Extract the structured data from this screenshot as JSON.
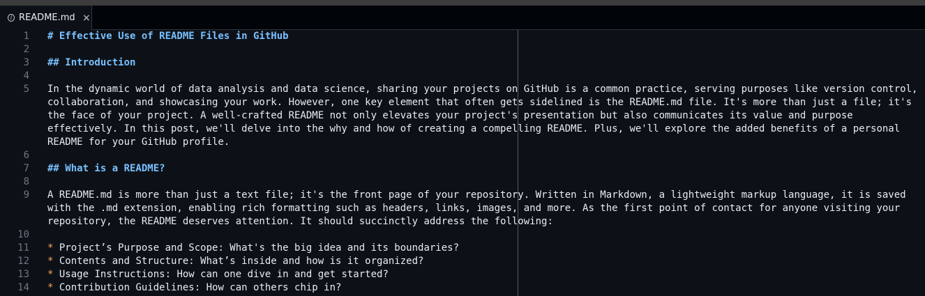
{
  "tab": {
    "filename": "README.md",
    "info_glyph": "i",
    "close_glyph": "×"
  },
  "editor": {
    "lines": [
      {
        "num": "1",
        "text": "# Effective Use of README Files in GitHub"
      },
      {
        "num": "2",
        "text": ""
      },
      {
        "num": "3",
        "text": "## Introduction"
      },
      {
        "num": "4",
        "text": ""
      },
      {
        "num": "5",
        "text": "In the dynamic world of data analysis and data science, sharing your projects on GitHub is a common practice, serving purposes like version control,"
      },
      {
        "num": "",
        "text": "collaboration, and showcasing your work. However, one key element that often gets sidelined is the README.md file. It's more than just a file; it's"
      },
      {
        "num": "",
        "text": "the face of your project. A well-crafted README not only elevates your project's presentation but also communicates its value and purpose"
      },
      {
        "num": "",
        "text": "effectively. In this post, we'll delve into the why and how of creating a compelling README. Plus, we'll explore the added benefits of a personal"
      },
      {
        "num": "",
        "text": "README for your GitHub profile."
      },
      {
        "num": "6",
        "text": ""
      },
      {
        "num": "7",
        "text": "## What is a README?"
      },
      {
        "num": "8",
        "text": ""
      },
      {
        "num": "9",
        "text": "A README.md is more than just a text file; it's the front page of your repository. Written in Markdown, a lightweight markup language, it is saved"
      },
      {
        "num": "",
        "text": "with the .md extension, enabling rich formatting such as headers, links, images, and more. As the first point of contact for anyone visiting your"
      },
      {
        "num": "",
        "text": "repository, the README deserves attention. It should succinctly address the following:"
      },
      {
        "num": "10",
        "text": ""
      },
      {
        "num": "11",
        "bullet": "*",
        "text": " Project’s Purpose and Scope: What's the big idea and its boundaries?"
      },
      {
        "num": "12",
        "bullet": "*",
        "text": " Contents and Structure: What’s inside and how is it organized?"
      },
      {
        "num": "13",
        "bullet": "*",
        "text": " Usage Instructions: How can one dive in and get started?"
      },
      {
        "num": "14",
        "bullet": "*",
        "text": " Contribution Guidelines: How can others chip in?"
      }
    ]
  },
  "colors": {
    "background": "#0d1117",
    "heading": "#79c0ff",
    "bullet": "#ffa657",
    "text": "#e6edf3",
    "line_number": "#6e7681"
  }
}
